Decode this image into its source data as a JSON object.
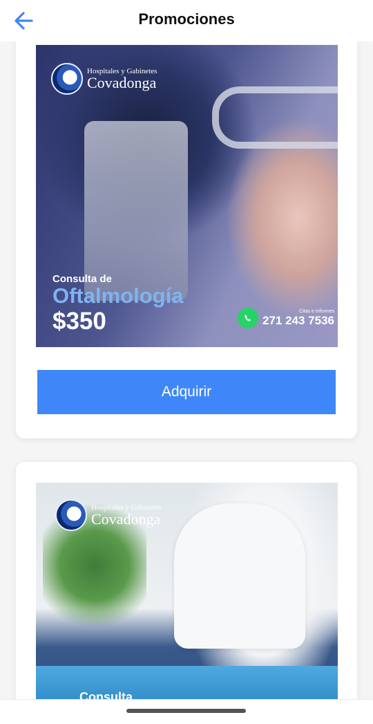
{
  "header": {
    "title": "Promociones",
    "back_icon": "arrow-left-icon"
  },
  "colors": {
    "accent": "#3f87f8",
    "title_text": "#111111",
    "background": "#f5f5f6"
  },
  "promotions": [
    {
      "logo_small": "Hospitales y Gabinetes",
      "logo_big": "Covadonga",
      "label": "Consulta de",
      "specialty": "Oftalmología",
      "price": "$350",
      "contact_label": "Citas e Informes",
      "phone": "271 243 7536",
      "button_label": "Adquirir"
    },
    {
      "logo_small": "Hospitales y Gabinetes",
      "logo_big": "Covadonga",
      "label": "Consulta"
    }
  ]
}
